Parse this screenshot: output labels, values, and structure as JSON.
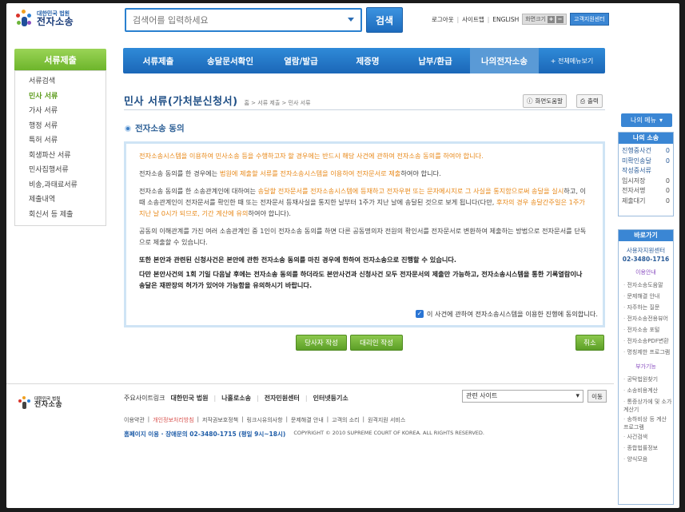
{
  "header": {
    "logo_small": "대한민국 법원",
    "logo_big": "전자소송",
    "search_placeholder": "검색어를 입력하세요",
    "search_button": "검색",
    "util": {
      "logout": "로그아웃",
      "sitemap": "사이트맵",
      "english": "ENGLISH",
      "zoom_label": "화면크기",
      "support": "고객지원센터"
    }
  },
  "left_nav": {
    "title": "서류제출",
    "items": [
      "서류검색",
      "민사 서류",
      "가사 서류",
      "행정 서류",
      "특허 서류",
      "회생파산 서류",
      "민사집행서류",
      "비송,과태료서류",
      "제출내역",
      "회신서 등 제출"
    ],
    "active_index": 1
  },
  "main_nav": {
    "items": [
      "서류제출",
      "송달문서확인",
      "열람/발급",
      "제증명",
      "납부/환급",
      "나의전자소송"
    ],
    "all_menu": "+ 전체메뉴보기",
    "active_index": 5
  },
  "page": {
    "title": "민사 서류(가처분신청서)",
    "breadcrumb": "홈 > 서류 제출 > 민사 서류",
    "help_button": "화면도움말",
    "print_button": "출력",
    "section_title": "전자소송 동의"
  },
  "content": {
    "p1": "전자소송시스템을 이용하여 민사소송 등을 수행하고자 할 경우에는 반드시 해당 사건에 관하여 전자소송 동의를 하여야 합니다.",
    "p2_a": "전자소송 동의를 한 경우에는 ",
    "p2_b": "법원에 제출할 서류를 전자소송시스템을 이용하여 전자문서로 제출",
    "p2_c": "하여야 합니다.",
    "p3_a": "전자소송 동의를 한 소송관계인에 대하여는 ",
    "p3_b": "송달할 전자문서를 전자소송시스템에 등재하고 전자우편 또는 문자메시지로 그 사실을 통지함으로써 송달을 실시",
    "p3_c": "하고, 이때 소송관계인이 전자문서를 확인한 때 또는 전자문서 등재사실을 통지한 날부터 1주가 지난 날에 송달된 것으로 보게 됩니다(다만, ",
    "p3_d": "후자의 경우 송달간주일은 1주가 지난 날 0시가 되므로, 기간 계산에 유의",
    "p3_e": "하여야 합니다).",
    "p4": "공동의 이해관계를 가진 여러 소송관계인 중 1인이 전자소송 동의를 하면 다른 공동명의자 전원의 확인서를 전자문서로 변환하여 제출하는 방법으로 전자문서를 단독으로 제출할 수 있습니다.",
    "p5": "또한 본안과 관련된 신청사건은 본안에 관한 전자소송 동의를 마친 경우에 한하여 전자소송으로 진행할 수 있습니다.",
    "p6": "다만 본안사건의 1회 기일 다음날 후에는 전자소송 동의를 하더라도 본안사건과 신청사건 모두 전자문서의 제출만 가능하고, 전자소송시스템을 통한 기록열람이나 송달은 재판장의 허가가 있어야 가능함을 유의하시기 바랍니다.",
    "agree_text": "이 사건에 관하여 전자소송시스템을 이용한 진행에 동의합니다.",
    "agree_checked": true
  },
  "buttons": {
    "party": "당사자 작성",
    "agent": "대리인 작성",
    "cancel": "취소"
  },
  "right": {
    "menu_button": "나의 메뉴",
    "my_title": "나의 소송",
    "my_rows": [
      {
        "label": "진행중사건",
        "value": "0",
        "gray": false
      },
      {
        "label": "미확인송달",
        "value": "0",
        "gray": false
      },
      {
        "label": "작성중서류",
        "value": "",
        "gray": false
      },
      {
        "label": "임시저장",
        "value": "0",
        "gray": true
      },
      {
        "label": "전자서명",
        "value": "0",
        "gray": true
      },
      {
        "label": "제출대기",
        "value": "0",
        "gray": true
      }
    ],
    "quick_title": "바로가기",
    "call_center": "사용자지원센터",
    "call_number": "02-3480-1716",
    "guide_title": "이용안내",
    "guide_links": [
      "전자소송도움말",
      "문제해결 안내",
      "자주하는 질문",
      "전자소송전용뷰어",
      "전자소송 포털",
      "전자소송PDF변환",
      "명칭제한 프로그램"
    ],
    "extra_title": "부가기능",
    "extra_links": [
      "공탁법원찾기",
      "소송비용계산",
      "통증상가에 및 소가계산기",
      "송하비상 등 계산 프로그램",
      "사건검색",
      "종합법률정보",
      "양식모음"
    ]
  },
  "footer": {
    "logo_small": "대한민국 법원",
    "logo_big": "전자소송",
    "related_label": "주요사이트링크",
    "related_links": [
      "대한민국 법원",
      "나홀로소송",
      "전자민원센터",
      "인터넷등기소"
    ],
    "select_value": "관련 사이트",
    "go_button": "이동",
    "links2": [
      "이용약관",
      "개인정보처리방침",
      "저작권보호정책",
      "링크시유의사항",
      "문제해결 안내",
      "고객의 소리",
      "원격지원 서비스"
    ],
    "contact": "홈페이지 이용 · 장애문의 02-3480-1715 (평일 9시~18시)",
    "copyright": "COPYRIGHT © 2010 SUPREME COURT OF KOREA. ALL RIGHTS RESERVED."
  }
}
